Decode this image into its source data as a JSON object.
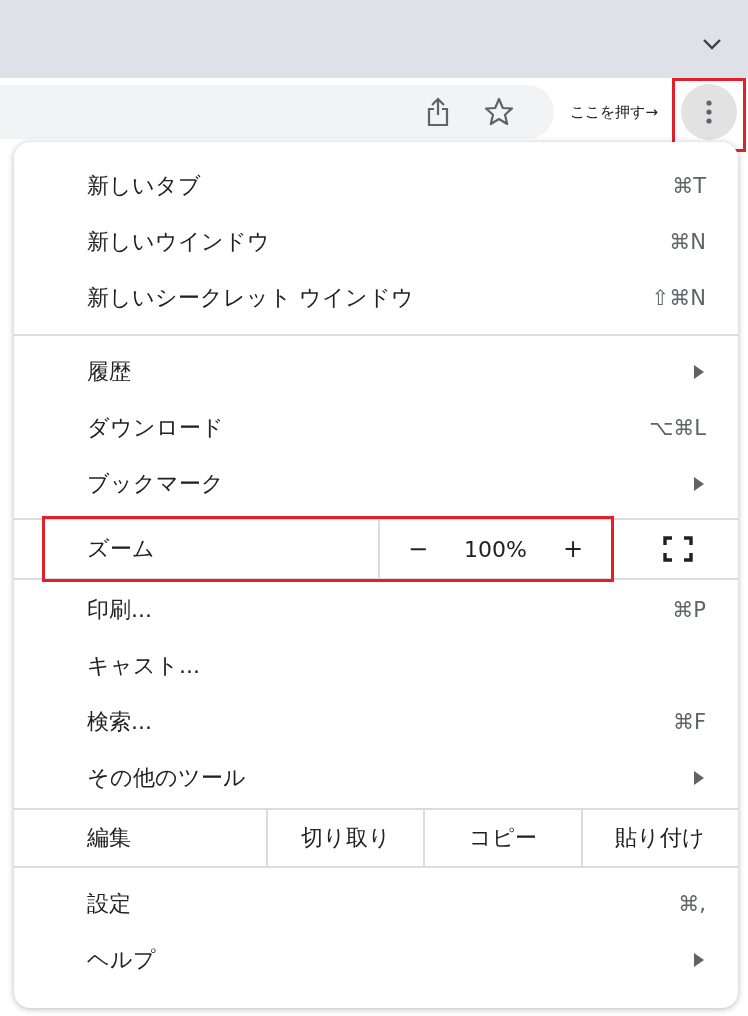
{
  "toolbar": {
    "callout": "ここを押す→",
    "menu_button": {
      "highlighted": true
    }
  },
  "menu": {
    "sections": [
      {
        "items": [
          {
            "kind": "item",
            "label": "新しいタブ",
            "shortcut": "⌘T",
            "submenu": false
          },
          {
            "kind": "item",
            "label": "新しいウインドウ",
            "shortcut": "⌘N",
            "submenu": false
          },
          {
            "kind": "item",
            "label": "新しいシークレット ウインドウ",
            "shortcut": "⇧⌘N",
            "submenu": false
          }
        ]
      },
      {
        "items": [
          {
            "kind": "item",
            "label": "履歴",
            "submenu": true
          },
          {
            "kind": "item",
            "label": "ダウンロード",
            "shortcut": "⌥⌘L",
            "submenu": false
          },
          {
            "kind": "item",
            "label": "ブックマーク",
            "submenu": true
          },
          {
            "kind": "zoom",
            "label": "ズーム",
            "minus": "−",
            "value": "100%",
            "plus": "+",
            "highlighted": true
          },
          {
            "kind": "item",
            "label": "印刷...",
            "shortcut": "⌘P",
            "submenu": false
          },
          {
            "kind": "item",
            "label": "キャスト...",
            "submenu": false
          },
          {
            "kind": "item",
            "label": "検索...",
            "shortcut": "⌘F",
            "submenu": false
          },
          {
            "kind": "item",
            "label": "その他のツール",
            "submenu": true
          },
          {
            "kind": "edit",
            "label": "編集",
            "actions": [
              "切り取り",
              "コピー",
              "貼り付け"
            ]
          }
        ]
      },
      {
        "items": [
          {
            "kind": "item",
            "label": "設定",
            "shortcut": "⌘,",
            "submenu": false
          },
          {
            "kind": "item",
            "label": "ヘルプ",
            "submenu": true
          }
        ]
      }
    ]
  }
}
